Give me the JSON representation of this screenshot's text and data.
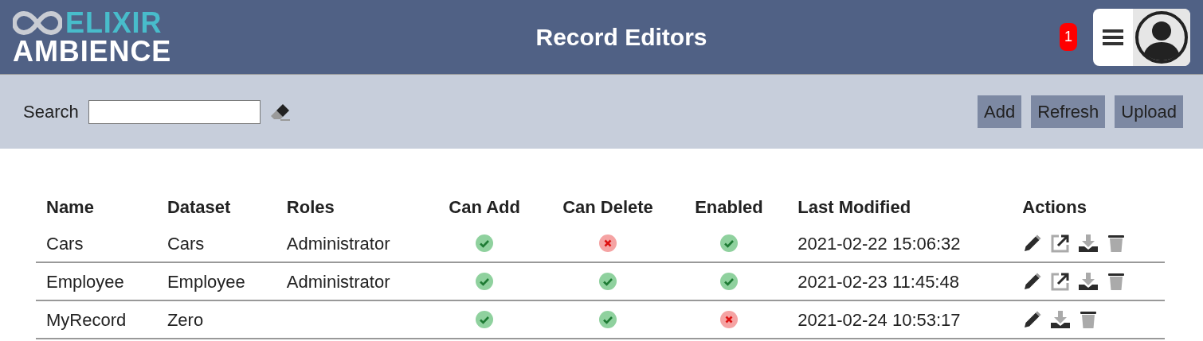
{
  "logo": {
    "line_1": "ELIXIR",
    "line_2": "AMBIENCE"
  },
  "header": {
    "title": "Record Editors",
    "notification_count": "1"
  },
  "toolbar": {
    "search_label": "Search",
    "buttons": [
      "Add",
      "Refresh",
      "Upload"
    ]
  },
  "table": {
    "columns": [
      "Name",
      "Dataset",
      "Roles",
      "Can Add",
      "Can Delete",
      "Enabled",
      "Last Modified",
      "Actions"
    ],
    "rows": [
      {
        "name": "Cars",
        "dataset": "Cars",
        "roles": "Administrator",
        "can_add": true,
        "can_delete": false,
        "enabled": true,
        "last_modified": "2021-02-22 15:06:32",
        "actions": [
          {
            "kind": "edit"
          },
          {
            "kind": "open"
          },
          {
            "kind": "download"
          },
          {
            "kind": "delete"
          }
        ]
      },
      {
        "name": "Employee",
        "dataset": "Employee",
        "roles": "Administrator",
        "can_add": true,
        "can_delete": true,
        "enabled": true,
        "last_modified": "2021-02-23 11:45:48",
        "actions": [
          {
            "kind": "edit"
          },
          {
            "kind": "open"
          },
          {
            "kind": "download"
          },
          {
            "kind": "delete"
          }
        ]
      },
      {
        "name": "MyRecord",
        "dataset": "Zero",
        "can_add": true,
        "can_delete": true,
        "enabled": false,
        "last_modified": "2021-02-24 10:53:17",
        "actions": [
          {
            "kind": "edit"
          },
          {
            "kind": "download"
          },
          {
            "kind": "delete"
          }
        ]
      }
    ]
  }
}
